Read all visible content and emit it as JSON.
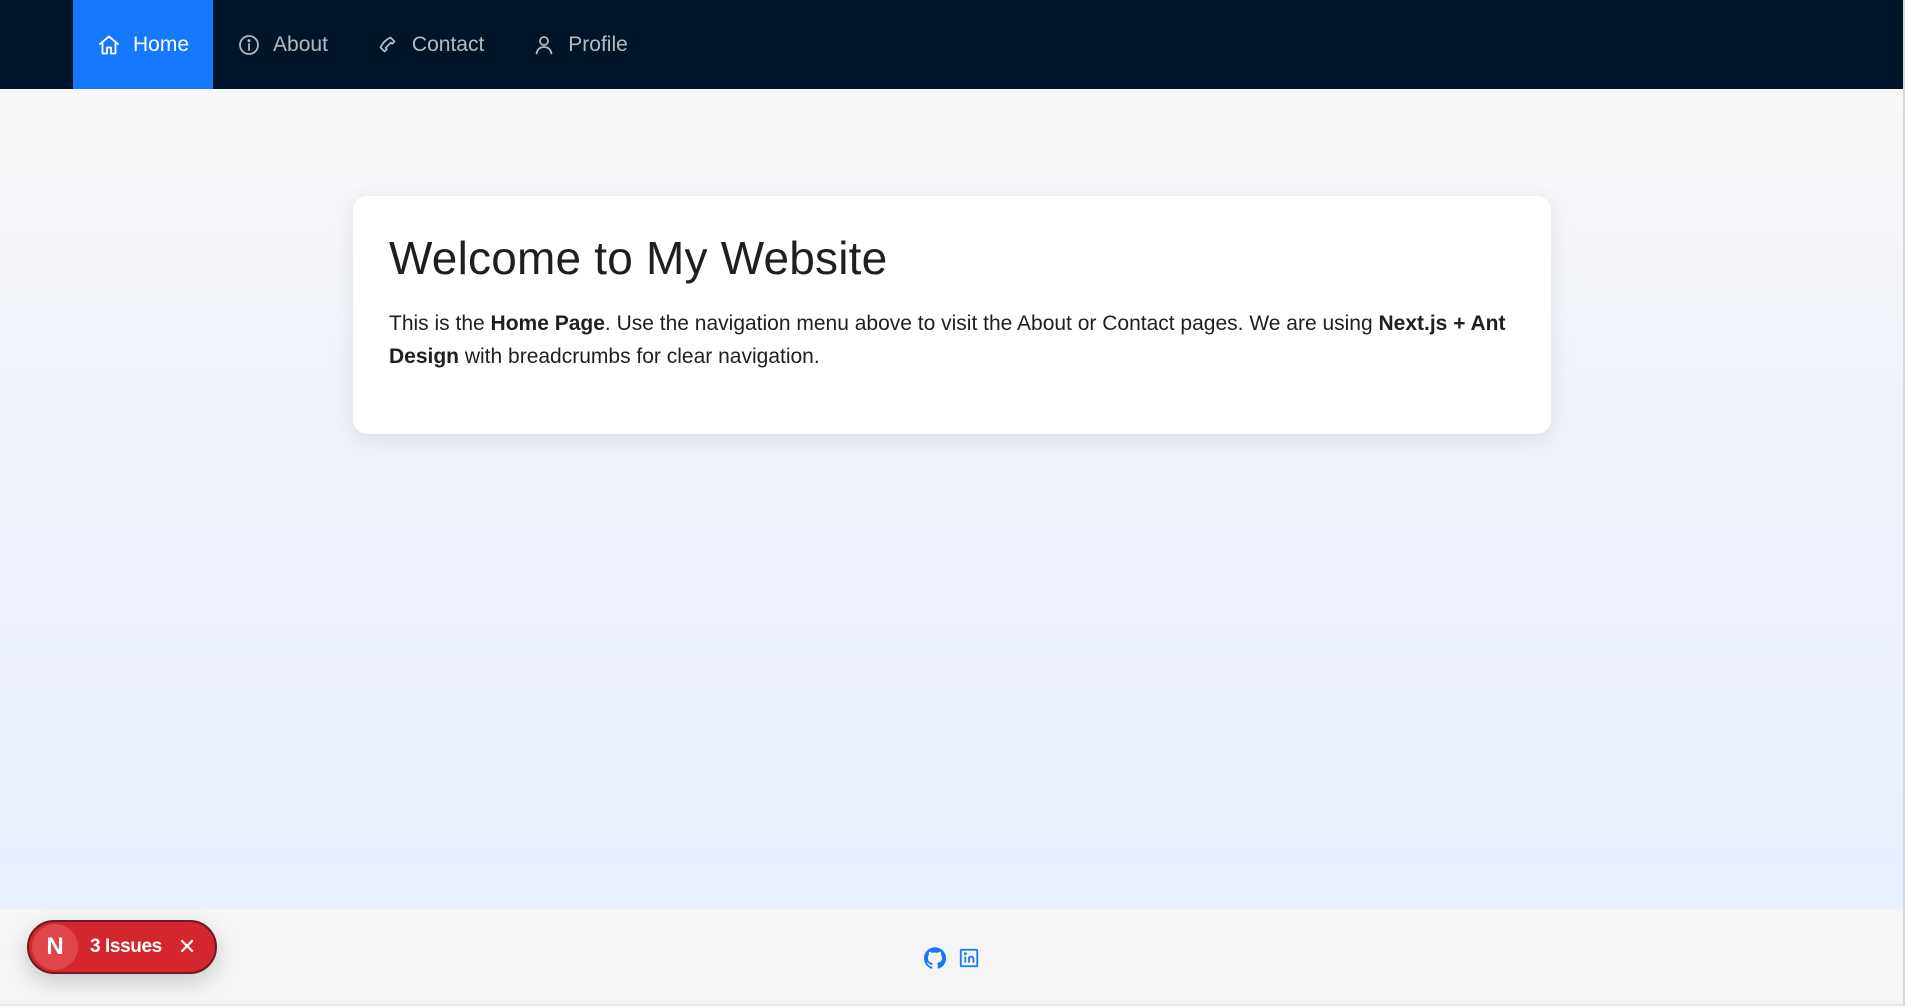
{
  "nav": {
    "items": [
      {
        "label": "Home",
        "icon": "home-icon",
        "active": true
      },
      {
        "label": "About",
        "icon": "info-circle-icon",
        "active": false
      },
      {
        "label": "Contact",
        "icon": "phone-icon",
        "active": false
      },
      {
        "label": "Profile",
        "icon": "user-icon",
        "active": false
      }
    ],
    "colors": {
      "background": "#001529",
      "active": "#1677ff"
    }
  },
  "main": {
    "title": "Welcome to My Website",
    "body": {
      "part1": "This is the ",
      "bold1": "Home Page",
      "part2": ". Use the navigation menu above to visit the About or Contact pages. We are using ",
      "bold2": "Next.js + Ant Design",
      "part3": " with breadcrumbs for clear navigation."
    }
  },
  "footer": {
    "links": [
      {
        "icon": "github-icon"
      },
      {
        "icon": "linkedin-icon"
      }
    ],
    "link_color": "#1677ff"
  },
  "issues": {
    "logo": "N",
    "count_label": "3 Issues",
    "close": "✕",
    "color": "#d3262e"
  }
}
